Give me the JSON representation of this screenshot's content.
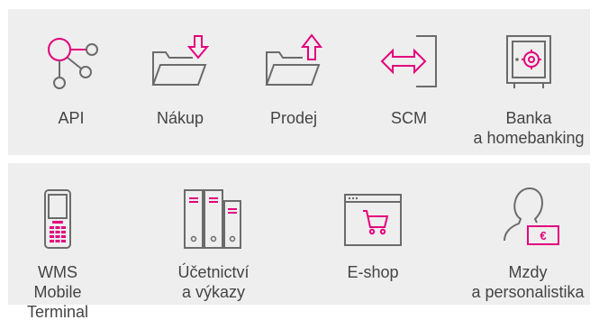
{
  "colors": {
    "accent": "#e4007c",
    "stroke": "#6b6b6b",
    "panel": "#eeeeee",
    "text": "#444444"
  },
  "rows": [
    {
      "items": [
        {
          "id": "api",
          "icon": "api-graph-icon",
          "label": "API"
        },
        {
          "id": "nakup",
          "icon": "folder-download-icon",
          "label": "Nákup"
        },
        {
          "id": "prodej",
          "icon": "folder-upload-icon",
          "label": "Prodej"
        },
        {
          "id": "scm",
          "icon": "exchange-arrows-icon",
          "label": "SCM"
        },
        {
          "id": "banka",
          "icon": "safe-icon",
          "label": "Banka\na homebanking"
        }
      ]
    },
    {
      "items": [
        {
          "id": "wms",
          "icon": "handheld-terminal-icon",
          "label": "WMS\nMobile\nTerminal"
        },
        {
          "id": "ucetnictvi",
          "icon": "binders-icon",
          "label": "Účetnictví\na výkazy"
        },
        {
          "id": "eshop",
          "icon": "shopping-cart-browser-icon",
          "label": "E-shop"
        },
        {
          "id": "mzdy",
          "icon": "person-money-icon",
          "label": "Mzdy\na personalistika"
        }
      ]
    }
  ]
}
